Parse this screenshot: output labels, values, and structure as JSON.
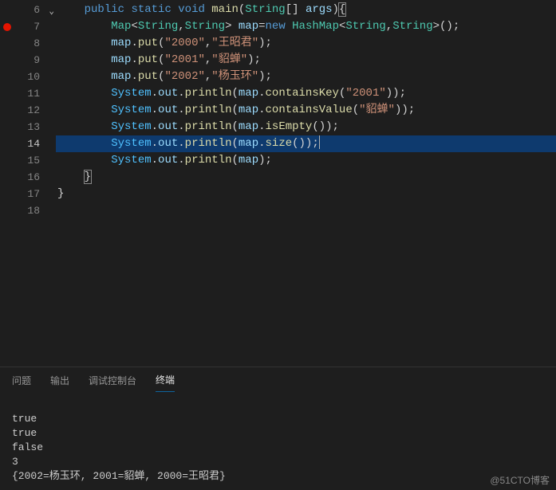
{
  "gutter": {
    "lines": [
      "6",
      "7",
      "8",
      "9",
      "10",
      "11",
      "12",
      "13",
      "14",
      "15",
      "16",
      "17",
      "18"
    ],
    "fold_line": "6",
    "breakpoint_line": "7",
    "active_line": "14"
  },
  "code": {
    "l6": {
      "kw1": "public",
      "kw2": "static",
      "kw3": "void",
      "method": "main",
      "type": "String",
      "brackets": "[]",
      "var": "args"
    },
    "l7": {
      "type1": "Map",
      "type2": "String",
      "type3": "String",
      "var": "map",
      "kw": "new",
      "type4": "HashMap",
      "type5": "String",
      "type6": "String"
    },
    "l8": {
      "var": "map",
      "method": "put",
      "str1": "\"2000\"",
      "str2": "\"王昭君\""
    },
    "l9": {
      "var": "map",
      "method": "put",
      "str1": "\"2001\"",
      "str2": "\"貂蝉\""
    },
    "l10": {
      "var": "map",
      "method": "put",
      "str1": "\"2002\"",
      "str2": "\"杨玉环\""
    },
    "l11": {
      "obj": "System",
      "field": "out",
      "method1": "println",
      "var": "map",
      "method2": "containsKey",
      "str": "\"2001\""
    },
    "l12": {
      "obj": "System",
      "field": "out",
      "method1": "println",
      "var": "map",
      "method2": "containsValue",
      "str": "\"貂蝉\""
    },
    "l13": {
      "obj": "System",
      "field": "out",
      "method1": "println",
      "var": "map",
      "method2": "isEmpty"
    },
    "l14": {
      "obj": "System",
      "field": "out",
      "method1": "println",
      "var": "map",
      "method2": "size"
    },
    "l15": {
      "obj": "System",
      "field": "out",
      "method1": "println",
      "var": "map"
    }
  },
  "panel": {
    "tabs": {
      "problems": "问题",
      "output": "输出",
      "debug": "调试控制台",
      "terminal": "终端"
    },
    "active_tab": "terminal",
    "output": {
      "line1": "true",
      "line2": "true",
      "line3": "false",
      "line4": "3",
      "line5": "{2002=杨玉环, 2001=貂蝉, 2000=王昭君}"
    }
  },
  "watermark": "@51CTO博客"
}
